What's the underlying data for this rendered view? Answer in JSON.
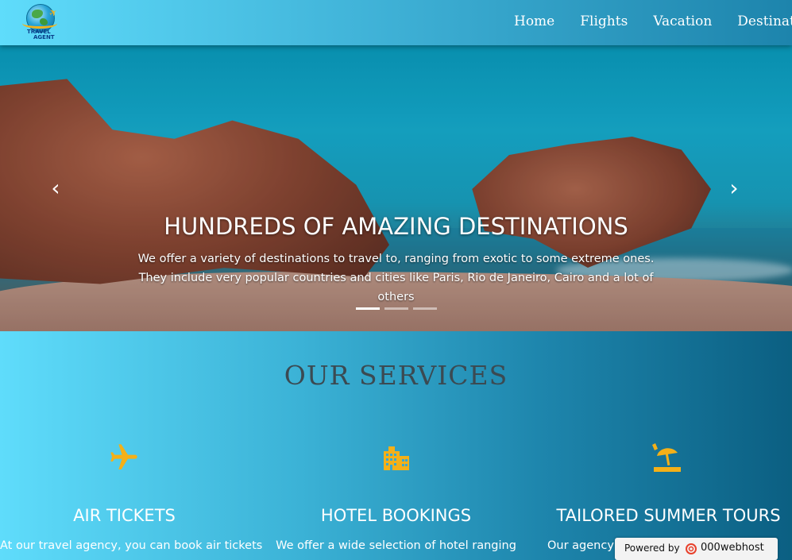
{
  "header": {
    "logo_text_1": "TRAVEL",
    "logo_text_2": "AGENT",
    "nav": [
      {
        "label": "Home"
      },
      {
        "label": "Flights"
      },
      {
        "label": "Vacation"
      },
      {
        "label": "Destinations"
      }
    ]
  },
  "hero": {
    "title": "HUNDREDS OF AMAZING DESTINATIONS",
    "text": "We offer a variety of destinations to travel to, ranging from exotic to some extreme ones. They include very popular countries and cities like Paris, Rio de Janeiro, Cairo and a lot of others",
    "prev_icon": "chevron-left-icon",
    "next_icon": "chevron-right-icon",
    "prev_glyph": "‹",
    "next_glyph": "›",
    "slides": 3,
    "active_slide": 1
  },
  "services": {
    "title": "OUR SERVICES",
    "items": [
      {
        "icon": "airplane-icon",
        "title": "AIR TICKETS",
        "text": "At our travel agency, you can book air tickets"
      },
      {
        "icon": "hotel-icon",
        "title": "HOTEL BOOKINGS",
        "text": "We offer a wide selection of hotel ranging"
      },
      {
        "icon": "beach-umbrella-icon",
        "title": "TAILORED SUMMER TOURS",
        "text": "Our agency provides trips including"
      }
    ],
    "icon_color": "#f4b018"
  },
  "badge": {
    "powered_by": "Powered by",
    "host": "000webhost"
  }
}
